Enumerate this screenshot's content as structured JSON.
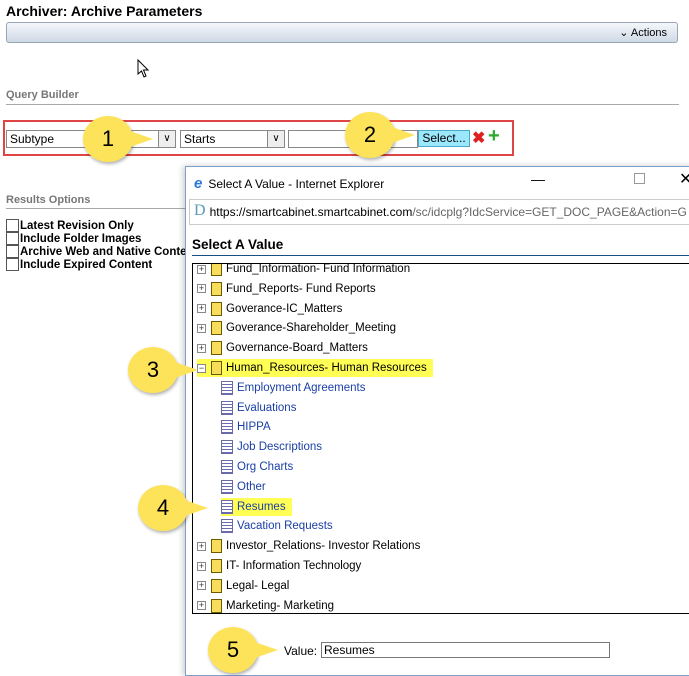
{
  "page": {
    "title": "Archiver: Archive Parameters",
    "actions_label": "Actions",
    "actions_icon": "chevron-down-icon"
  },
  "query_builder": {
    "heading": "Query Builder",
    "field": "Subtype",
    "operator": "Starts",
    "value": "",
    "select_label": "Select...",
    "remove_icon": "x-icon",
    "add_icon": "plus-icon"
  },
  "results_options": {
    "heading": "Results Options",
    "options": [
      "Latest Revision Only",
      "Include Folder Images",
      "Archive Web and Native Conter",
      "Include Expired Content"
    ]
  },
  "dialog": {
    "window_title": "Select A Value - Internet Explorer",
    "url_host": "https://smartcabinet.smartcabinet.com",
    "url_path": "/sc/idcplg?IdcService=GET_DOC_PAGE&Action=G",
    "heading": "Select A Value",
    "tree": [
      {
        "label": "Fund_Information- Fund Information",
        "type": "folder"
      },
      {
        "label": "Fund_Reports- Fund Reports",
        "type": "folder"
      },
      {
        "label": "Goverance-IC_Matters",
        "type": "folder"
      },
      {
        "label": "Goverance-Shareholder_Meeting",
        "type": "folder"
      },
      {
        "label": "Governance-Board_Matters",
        "type": "folder"
      },
      {
        "label": "Human_Resources- Human Resources",
        "type": "folder",
        "expanded": true,
        "highlighted": true
      },
      {
        "label": "Employment Agreements",
        "type": "child"
      },
      {
        "label": "Evaluations",
        "type": "child"
      },
      {
        "label": "HIPPA",
        "type": "child"
      },
      {
        "label": "Job Descriptions",
        "type": "child"
      },
      {
        "label": "Org Charts",
        "type": "child"
      },
      {
        "label": "Other",
        "type": "child"
      },
      {
        "label": "Resumes",
        "type": "child",
        "highlighted": true
      },
      {
        "label": "Vacation Requests",
        "type": "child"
      },
      {
        "label": "Investor_Relations- Investor Relations",
        "type": "folder"
      },
      {
        "label": "IT- Information Technology",
        "type": "folder"
      },
      {
        "label": "Legal- Legal",
        "type": "folder"
      },
      {
        "label": "Marketing- Marketing",
        "type": "folder"
      }
    ],
    "value_label": "Value:",
    "value": "Resumes"
  },
  "callouts": [
    "1",
    "2",
    "3",
    "4",
    "5"
  ]
}
